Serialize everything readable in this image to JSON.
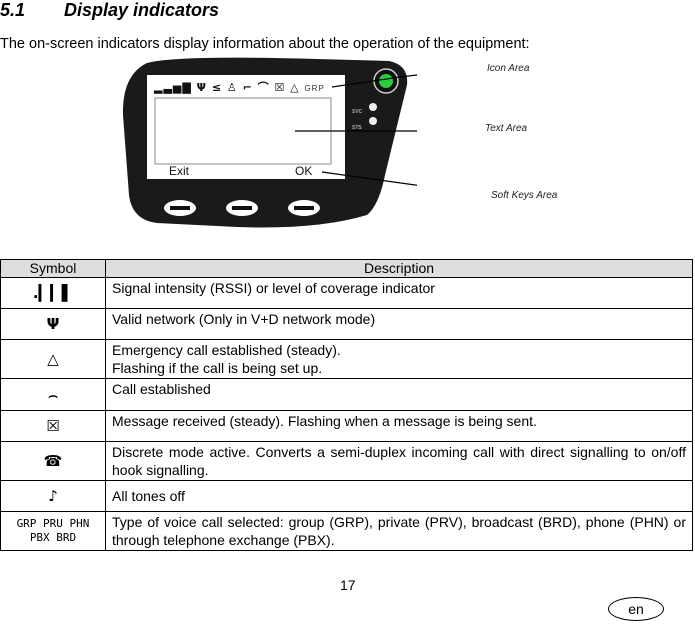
{
  "section": {
    "number": "5.1",
    "title": "Display indicators"
  },
  "intro": "The on-screen indicators display information about the operation of the equipment:",
  "figure": {
    "screen_icon_row": "▂▃▅▇ Ψ ≤ ♙ ⌐ ⌒ ☒ △",
    "screen_call_type": "GRP",
    "softkey_left": "Exit",
    "softkey_right": "OK",
    "led_labels": [
      "SVC",
      "STS"
    ],
    "callouts": [
      "Icon Area",
      "Text Area",
      "Soft Keys Area"
    ],
    "colors": {
      "body": "#1a1a1a",
      "screen": "#ffffff",
      "power_button": "#2ecc40"
    }
  },
  "table": {
    "headers": [
      "Symbol",
      "Description"
    ],
    "rows": [
      {
        "icon": "signal-strength-icon",
        "glyph": ".▎▎▌",
        "description": [
          "Signal intensity (RSSI) or level of coverage indicator"
        ]
      },
      {
        "icon": "valid-network-icon",
        "glyph": "Ψ",
        "description": [
          "Valid network (Only in V+D network mode)"
        ]
      },
      {
        "icon": "emergency-icon",
        "glyph": "△",
        "description": [
          "Emergency call established (steady).",
          "Flashing if the call is being set up."
        ]
      },
      {
        "icon": "call-established-icon",
        "glyph": "⌢",
        "description": [
          "Call established"
        ]
      },
      {
        "icon": "message-icon",
        "glyph": "☒",
        "description": [
          "Message received (steady). Flashing when a message is being sent."
        ]
      },
      {
        "icon": "discrete-mode-icon",
        "glyph": "☎",
        "description": [
          "Discrete mode active. Converts a semi-duplex incoming call with direct signalling to on/off hook signalling."
        ]
      },
      {
        "icon": "tones-off-icon",
        "glyph": "♪",
        "description": [
          "All tones off"
        ]
      },
      {
        "icon": "call-type-icon",
        "glyph_lines": [
          "GRP PRU PHN",
          "PBX BRD"
        ],
        "description": [
          "Type of voice call selected: group (GRP), private (PRV), broadcast (BRD), phone (PHN) or through telephone exchange (PBX)."
        ]
      }
    ]
  },
  "page_number": "17",
  "language": "en"
}
